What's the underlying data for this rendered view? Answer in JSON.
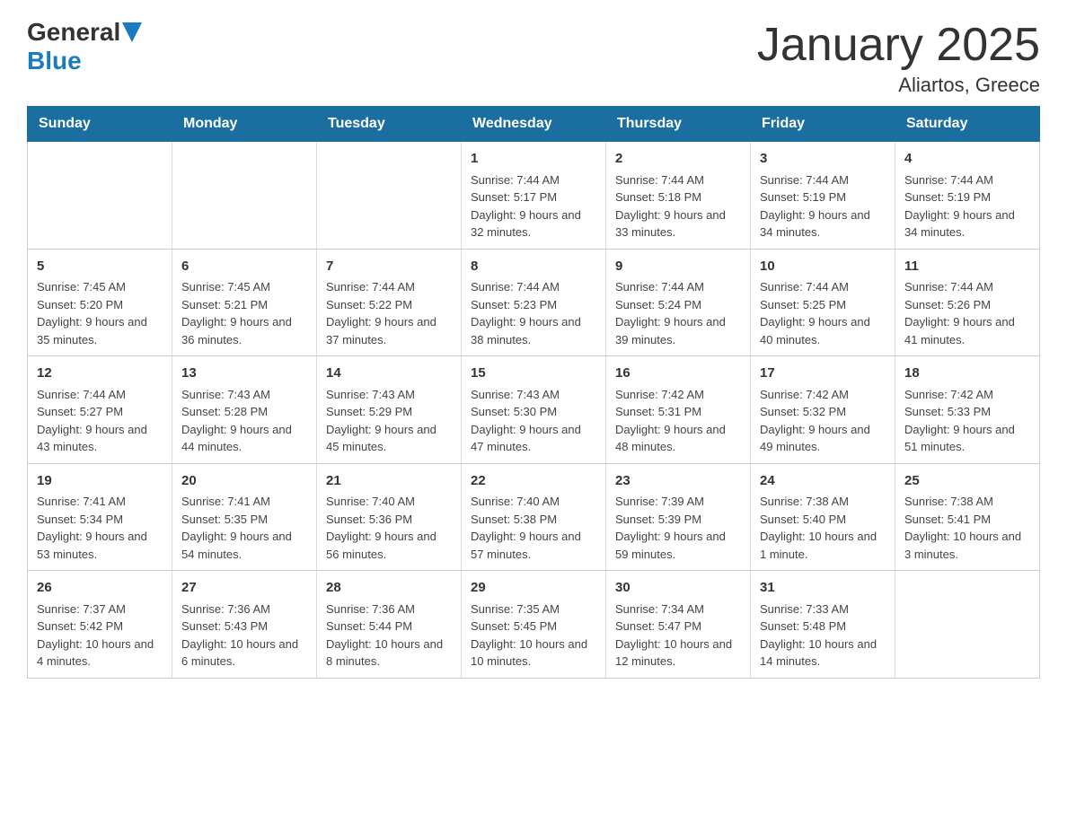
{
  "header": {
    "logo": {
      "general": "General",
      "blue": "Blue"
    },
    "title": "January 2025",
    "subtitle": "Aliartos, Greece"
  },
  "days": [
    "Sunday",
    "Monday",
    "Tuesday",
    "Wednesday",
    "Thursday",
    "Friday",
    "Saturday"
  ],
  "weeks": [
    [
      {
        "day": "",
        "info": ""
      },
      {
        "day": "",
        "info": ""
      },
      {
        "day": "",
        "info": ""
      },
      {
        "day": "1",
        "info": "Sunrise: 7:44 AM\nSunset: 5:17 PM\nDaylight: 9 hours and 32 minutes."
      },
      {
        "day": "2",
        "info": "Sunrise: 7:44 AM\nSunset: 5:18 PM\nDaylight: 9 hours and 33 minutes."
      },
      {
        "day": "3",
        "info": "Sunrise: 7:44 AM\nSunset: 5:19 PM\nDaylight: 9 hours and 34 minutes."
      },
      {
        "day": "4",
        "info": "Sunrise: 7:44 AM\nSunset: 5:19 PM\nDaylight: 9 hours and 34 minutes."
      }
    ],
    [
      {
        "day": "5",
        "info": "Sunrise: 7:45 AM\nSunset: 5:20 PM\nDaylight: 9 hours and 35 minutes."
      },
      {
        "day": "6",
        "info": "Sunrise: 7:45 AM\nSunset: 5:21 PM\nDaylight: 9 hours and 36 minutes."
      },
      {
        "day": "7",
        "info": "Sunrise: 7:44 AM\nSunset: 5:22 PM\nDaylight: 9 hours and 37 minutes."
      },
      {
        "day": "8",
        "info": "Sunrise: 7:44 AM\nSunset: 5:23 PM\nDaylight: 9 hours and 38 minutes."
      },
      {
        "day": "9",
        "info": "Sunrise: 7:44 AM\nSunset: 5:24 PM\nDaylight: 9 hours and 39 minutes."
      },
      {
        "day": "10",
        "info": "Sunrise: 7:44 AM\nSunset: 5:25 PM\nDaylight: 9 hours and 40 minutes."
      },
      {
        "day": "11",
        "info": "Sunrise: 7:44 AM\nSunset: 5:26 PM\nDaylight: 9 hours and 41 minutes."
      }
    ],
    [
      {
        "day": "12",
        "info": "Sunrise: 7:44 AM\nSunset: 5:27 PM\nDaylight: 9 hours and 43 minutes."
      },
      {
        "day": "13",
        "info": "Sunrise: 7:43 AM\nSunset: 5:28 PM\nDaylight: 9 hours and 44 minutes."
      },
      {
        "day": "14",
        "info": "Sunrise: 7:43 AM\nSunset: 5:29 PM\nDaylight: 9 hours and 45 minutes."
      },
      {
        "day": "15",
        "info": "Sunrise: 7:43 AM\nSunset: 5:30 PM\nDaylight: 9 hours and 47 minutes."
      },
      {
        "day": "16",
        "info": "Sunrise: 7:42 AM\nSunset: 5:31 PM\nDaylight: 9 hours and 48 minutes."
      },
      {
        "day": "17",
        "info": "Sunrise: 7:42 AM\nSunset: 5:32 PM\nDaylight: 9 hours and 49 minutes."
      },
      {
        "day": "18",
        "info": "Sunrise: 7:42 AM\nSunset: 5:33 PM\nDaylight: 9 hours and 51 minutes."
      }
    ],
    [
      {
        "day": "19",
        "info": "Sunrise: 7:41 AM\nSunset: 5:34 PM\nDaylight: 9 hours and 53 minutes."
      },
      {
        "day": "20",
        "info": "Sunrise: 7:41 AM\nSunset: 5:35 PM\nDaylight: 9 hours and 54 minutes."
      },
      {
        "day": "21",
        "info": "Sunrise: 7:40 AM\nSunset: 5:36 PM\nDaylight: 9 hours and 56 minutes."
      },
      {
        "day": "22",
        "info": "Sunrise: 7:40 AM\nSunset: 5:38 PM\nDaylight: 9 hours and 57 minutes."
      },
      {
        "day": "23",
        "info": "Sunrise: 7:39 AM\nSunset: 5:39 PM\nDaylight: 9 hours and 59 minutes."
      },
      {
        "day": "24",
        "info": "Sunrise: 7:38 AM\nSunset: 5:40 PM\nDaylight: 10 hours and 1 minute."
      },
      {
        "day": "25",
        "info": "Sunrise: 7:38 AM\nSunset: 5:41 PM\nDaylight: 10 hours and 3 minutes."
      }
    ],
    [
      {
        "day": "26",
        "info": "Sunrise: 7:37 AM\nSunset: 5:42 PM\nDaylight: 10 hours and 4 minutes."
      },
      {
        "day": "27",
        "info": "Sunrise: 7:36 AM\nSunset: 5:43 PM\nDaylight: 10 hours and 6 minutes."
      },
      {
        "day": "28",
        "info": "Sunrise: 7:36 AM\nSunset: 5:44 PM\nDaylight: 10 hours and 8 minutes."
      },
      {
        "day": "29",
        "info": "Sunrise: 7:35 AM\nSunset: 5:45 PM\nDaylight: 10 hours and 10 minutes."
      },
      {
        "day": "30",
        "info": "Sunrise: 7:34 AM\nSunset: 5:47 PM\nDaylight: 10 hours and 12 minutes."
      },
      {
        "day": "31",
        "info": "Sunrise: 7:33 AM\nSunset: 5:48 PM\nDaylight: 10 hours and 14 minutes."
      },
      {
        "day": "",
        "info": ""
      }
    ]
  ]
}
